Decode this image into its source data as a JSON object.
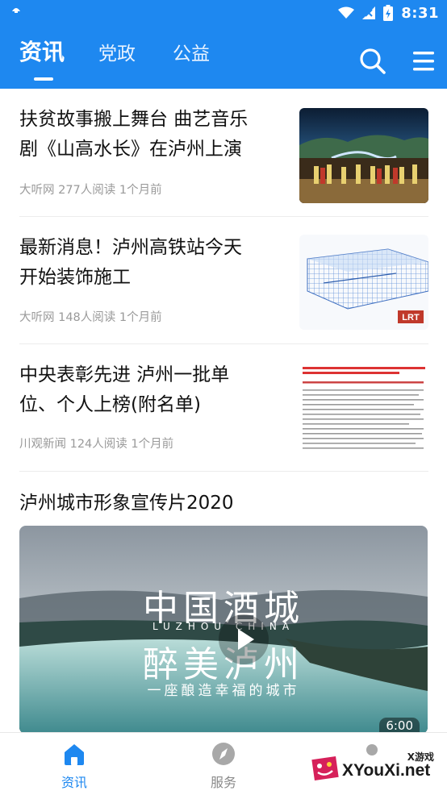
{
  "status_bar": {
    "time": "8:31"
  },
  "header": {
    "tabs": [
      {
        "label": "资讯",
        "active": true
      },
      {
        "label": "党政",
        "active": false
      },
      {
        "label": "公益",
        "active": false
      }
    ],
    "icons": [
      "search-icon",
      "menu-icon"
    ],
    "accent_color": "#1e88f0"
  },
  "articles": [
    {
      "title_line1": "扶贫故事搬上舞台 曲艺音乐",
      "title_line2": "剧《山高水长》在泸州上演",
      "source": "大听网",
      "reads": "277人阅读",
      "time": "1个月前"
    },
    {
      "title_line1": "最新消息！泸州高铁站今天",
      "title_line2": "开始装饰施工",
      "source": "大听网",
      "reads": "148人阅读",
      "time": "1个月前",
      "thumb_badge": "LRT"
    },
    {
      "title_line1": "中央表彰先进 泸州一批单",
      "title_line2": "位、个人上榜(附名单)",
      "source": "川观新闻",
      "reads": "124人阅读",
      "time": "1个月前"
    }
  ],
  "video": {
    "title": "泸州城市形象宣传片2020",
    "overlay_line1": "中国酒城",
    "overlay_sub": "LUZHOU  CHINA",
    "overlay_line2": "醉美泸州",
    "overlay_line3": "一座酿造幸福的城市",
    "duration": "6:00"
  },
  "bottom_nav": [
    {
      "label": "资讯",
      "icon": "home-icon",
      "active": true
    },
    {
      "label": "服务",
      "icon": "compass-icon",
      "active": false
    }
  ],
  "watermark": {
    "small": "X游戏",
    "big": "XYouXi.net"
  }
}
